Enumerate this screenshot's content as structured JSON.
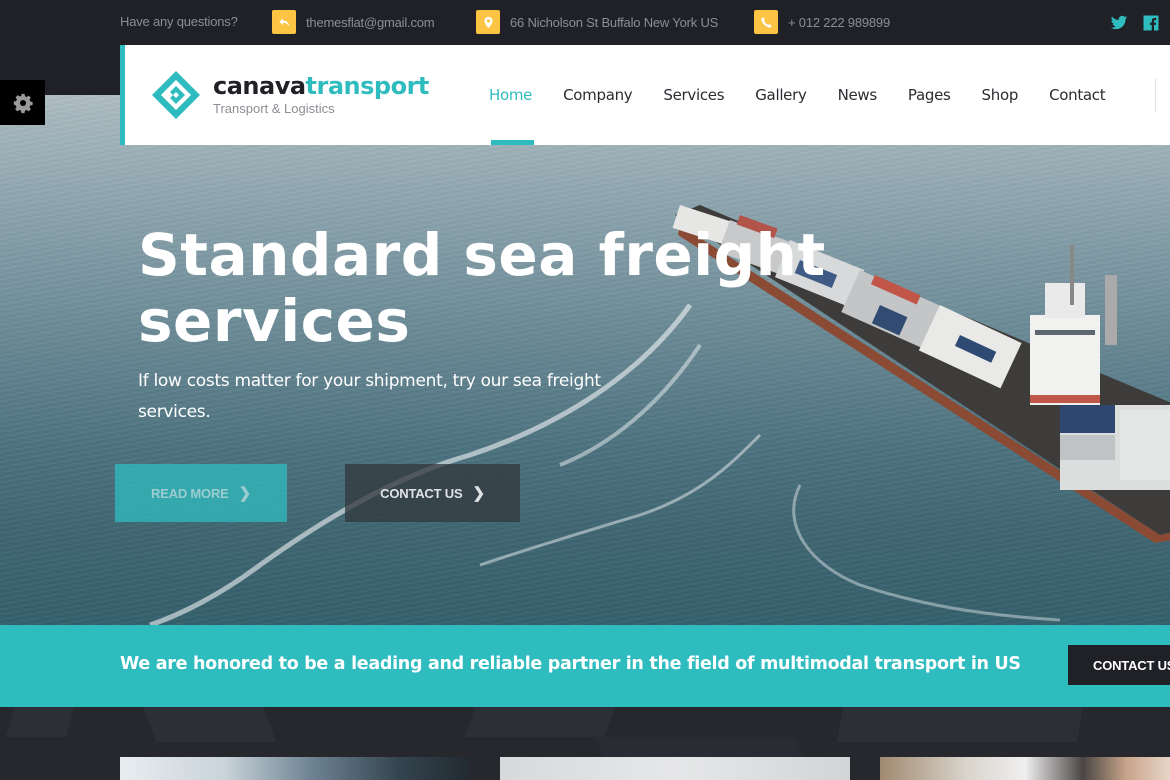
{
  "topbar": {
    "question": "Have any questions?",
    "email": {
      "icon": "reply-arrow-icon",
      "text": "themesflat@gmail.com"
    },
    "address": {
      "icon": "map-pin-icon",
      "text": "66 Nicholson St Buffalo New York US"
    },
    "phone": {
      "icon": "phone-icon",
      "text": "+ 012 222 989899"
    },
    "social": [
      "twitter",
      "facebook"
    ]
  },
  "logo": {
    "name_dark": "canava",
    "name_accent": "transport",
    "tagline": "Transport & Logistics"
  },
  "nav": {
    "items": [
      {
        "label": "Home",
        "active": true
      },
      {
        "label": "Company",
        "active": false
      },
      {
        "label": "Services",
        "active": false
      },
      {
        "label": "Gallery",
        "active": false
      },
      {
        "label": "News",
        "active": false
      },
      {
        "label": "Pages",
        "active": false
      },
      {
        "label": "Shop",
        "active": false
      },
      {
        "label": "Contact",
        "active": false
      }
    ]
  },
  "hero": {
    "title": "Standard sea freight services",
    "subtitle": "If low costs matter for your shipment, try our sea freight services.",
    "read_more": "READ MORE",
    "contact_us": "CONTACT US"
  },
  "band": {
    "text": "We are honored to be a leading and reliable partner in the field of multimodal transport in US",
    "button": "CONTACT US"
  },
  "colors": {
    "accent": "#2fbcbf",
    "dark": "#1f2127",
    "topbar_icon": "#fcc443"
  }
}
